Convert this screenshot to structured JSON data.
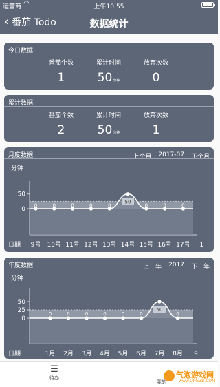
{
  "status": {
    "carrier": "运营商",
    "time": "上午10:55"
  },
  "nav": {
    "back_label": "番茄 Todo",
    "title": "数据统计"
  },
  "today": {
    "title": "今日数据",
    "count_label": "番茄个数",
    "count": "1",
    "time_label": "累计时间",
    "time": "50",
    "time_unit": "分钟",
    "abandon_label": "放弃次数",
    "abandon": "0"
  },
  "total": {
    "title": "累计数据",
    "count_label": "番茄个数",
    "count": "2",
    "time_label": "累计时间",
    "time": "50",
    "time_unit": "分钟",
    "abandon_label": "放弃次数",
    "abandon": "1"
  },
  "month": {
    "title": "月度数据",
    "prev": "上个月",
    "current": "2017-07",
    "next": "下个月",
    "ylabel": "分钟",
    "xlabel": "日期"
  },
  "year": {
    "title": "年度数据",
    "prev": "上一年",
    "current": "2017",
    "next": "下一年",
    "ylabel": "分钟",
    "xlabel": "日期"
  },
  "tabs": {
    "todo": "待办",
    "mine": "我的"
  },
  "watermark": {
    "main": "气泡游戏网",
    "sub": "www.QPGZB.COM"
  },
  "chart_data": [
    {
      "type": "area",
      "title": "月度数据",
      "ylabel": "分钟",
      "xlabel": "日期",
      "yticks": [
        0,
        50
      ],
      "ylim": [
        0,
        75
      ],
      "categories": [
        "9号",
        "10号",
        "11号",
        "12号",
        "13号",
        "14号",
        "15号",
        "16号",
        "17号",
        "1"
      ],
      "values": [
        0,
        0,
        0,
        0,
        0,
        50,
        0,
        0,
        0,
        null
      ],
      "band": [
        0,
        25
      ]
    },
    {
      "type": "area",
      "title": "年度数据",
      "ylabel": "分钟",
      "xlabel": "日期",
      "yticks": [
        0,
        25,
        50
      ],
      "ylim": [
        0,
        75
      ],
      "categories": [
        "1月",
        "2月",
        "3月",
        "4月",
        "5月",
        "6月",
        "7月",
        "8月",
        "9"
      ],
      "values": [
        0,
        0,
        0,
        0,
        0,
        0,
        50,
        0,
        null
      ],
      "band": [
        0,
        25
      ]
    }
  ],
  "colors": {
    "card": "#5c6677",
    "band": "#9aa1ad",
    "watermark": "#f39a1d"
  }
}
